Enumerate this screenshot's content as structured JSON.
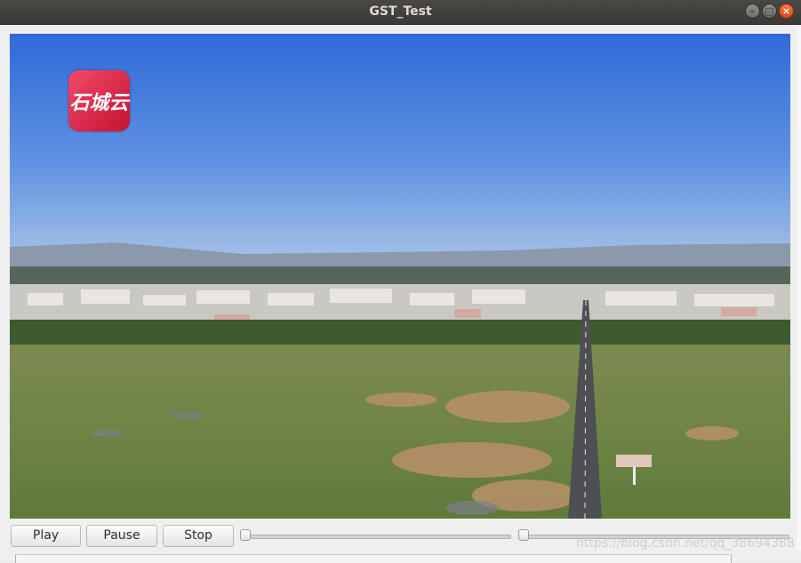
{
  "window": {
    "title": "GST_Test"
  },
  "video": {
    "logo_text": "石城云"
  },
  "controls": {
    "play_label": "Play",
    "pause_label": "Pause",
    "stop_label": "Stop",
    "position_value": 0,
    "volume_value": 0
  },
  "watermark": "https://blog.csdn.net/qq_38694388",
  "icons": {
    "minimize": "minimize-icon",
    "maximize": "maximize-icon",
    "close": "close-icon"
  }
}
